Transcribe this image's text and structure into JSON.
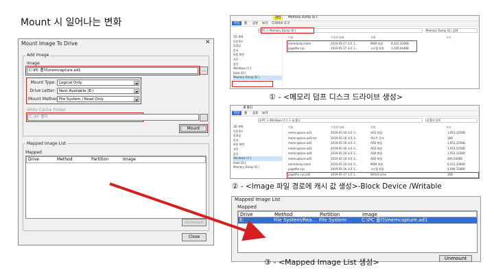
{
  "heading": "Mount 시 일어나는 변화",
  "dialog": {
    "title": "Mount Image To Drive",
    "close_glyph": "✕",
    "add_image_label": "Add Image",
    "image_label": "Image",
    "image_value": "C:\\PC 폴더\\memcapture.ad1",
    "browse_label": "...",
    "mount_type_label": "Mount Type:",
    "mount_type_value": "Logical Only",
    "drive_letter_label": "Drive Letter:",
    "drive_letter_value": "Next Available (E:)",
    "mount_method_label": "Mount Method:",
    "mount_method_value": "File System / Read Only",
    "write_cache_label": "Write Cache Folder",
    "write_cache_value": "C:\\PC 폴더",
    "mount_button": "Mount",
    "mapped_group_label": "Mapped Image List",
    "mapped_label": "Mapped",
    "columns": [
      "Drive",
      "Method",
      "Partition",
      "Image"
    ],
    "unmount_button": "Unmount",
    "close_button": "Close"
  },
  "explorer1": {
    "tab_label": "관리",
    "title": "Memory Dump (E:)",
    "menu": [
      "파일",
      "홈",
      "공유",
      "보기",
      "드라이브 도구"
    ],
    "address": "내 PC > Memory Dump (E:)",
    "search": "Memory Dump (E:) 검색",
    "nav": [
      "3D 개체",
      "다운로드",
      "동영상",
      "문서",
      "바탕 화면",
      "사진",
      "음악",
      "Windows (C:)",
      "Data (D:)",
      "Memory Dump (E:)"
    ],
    "columns": [
      "이름",
      "수정한 날짜",
      "유형",
      "크기"
    ],
    "files": [
      {
        "name": "memdump.mem",
        "date": "2019-05-17 오후 1...",
        "type": "MEM 파일",
        "size": "8,322,104KB"
      },
      {
        "name": "pagefile.sys",
        "date": "2019-05-17 오후 1...",
        "type": "시스템 파일",
        "size": "1,209,044KB"
      }
    ]
  },
  "caption1": "① - <메모리 덤프 디스크 드라이브 생성>",
  "explorer2": {
    "title": "새 폴더",
    "menu": [
      "파일",
      "홈",
      "공유",
      "보기"
    ],
    "address": "내 PC > Windows (C:) > 새 폴더",
    "search": "새 폴더 검색",
    "nav": [
      "3D 개체",
      "다운로드",
      "동영상",
      "문서",
      "바탕 화면",
      "사진",
      "음악",
      "Windows (C:)",
      "Data (D:)",
      "Memory Dump (E:)"
    ],
    "columns": [
      "이름",
      "수정한 날짜",
      "유형",
      "크기"
    ],
    "files": [
      {
        "name": "memcapture.ad1",
        "date": "2019-05-16 오후 3...",
        "type": "AD1 파일",
        "size": "1,953,125KB"
      },
      {
        "name": "memcapture.ad1.txt",
        "date": "2019-05-16 오후 3...",
        "type": "텍스트 문서",
        "size": "1KB"
      },
      {
        "name": "memcapture.ad2",
        "date": "2019-05-16 오후 3...",
        "type": "AD2 파일",
        "size": "1,953,125KB"
      },
      {
        "name": "memcapture.ad3",
        "date": "2019-05-16 오후 3...",
        "type": "AD3 파일",
        "size": "1,953,125KB"
      },
      {
        "name": "memcapture.ad4",
        "date": "2019-05-16 오후 3...",
        "type": "AD4 파일",
        "size": "1,953,125KB"
      },
      {
        "name": "memcapture.ad5",
        "date": "2019-05-16 오후 3...",
        "type": "AD5 파일",
        "size": "469,503KB"
      },
      {
        "name": "memdump.mem",
        "date": "2019-05-16 오후 3...",
        "type": "MEM 파일",
        "size": "8,322,104KB"
      },
      {
        "name": "pagefile.sys",
        "date": "2019-05-16 오후 3...",
        "type": "시스템 파일",
        "size": "4,096,734KB"
      },
      {
        "name": "pagefile.sys.ad1",
        "date": "2019-05-17 오후 1...",
        "type": "WriteCache",
        "size": "1KB"
      }
    ]
  },
  "caption2": "② - <Image 파일 경로에 캐시 값 생성>-Block Device /Writable",
  "mapped_panel": {
    "group_label": "Mapped Image List",
    "mapped_label": "Mapped",
    "columns": [
      "Drive",
      "Method",
      "Partition",
      "Image"
    ],
    "row": {
      "drive": "E:",
      "method": "File System/Rea...",
      "partition": "File System",
      "image": "C:\\PC 폴더\\memcapture.ad1"
    },
    "unmount_button": "Unmount"
  },
  "caption3": "③ - <Mapped Image List 생성>",
  "colors": {
    "highlight": "#d42020",
    "arrow": "#d42020",
    "selection": "#2f6fd6"
  }
}
